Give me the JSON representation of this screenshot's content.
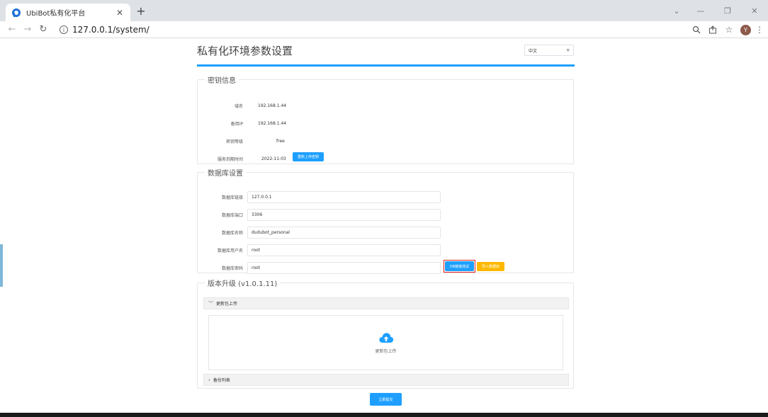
{
  "browser": {
    "tab_title": "UbiBot私有化平台",
    "url": "127.0.0.1/system/",
    "profile_initial": "Y"
  },
  "page": {
    "title": "私有化环境参数设置",
    "language": "中文"
  },
  "key_section": {
    "legend": "密钥信息",
    "fields": [
      {
        "label": "域名",
        "value": "192.168.1.44"
      },
      {
        "label": "备用IP",
        "value": "192.168.1.44"
      },
      {
        "label": "密钥等级",
        "value": "free"
      },
      {
        "label": "服务到期时间",
        "value": "2022-11-03"
      }
    ],
    "reupload_label": "重新上传密钥"
  },
  "db_section": {
    "legend": "数据库设置",
    "fields": [
      {
        "label": "数据库链接",
        "value": "127.0.0.1"
      },
      {
        "label": "数据库端口",
        "value": "3306"
      },
      {
        "label": "数据库名称",
        "value": "dudubot_personal"
      },
      {
        "label": "数据库用户名",
        "value": "root"
      },
      {
        "label": "数据库密码",
        "value": "root"
      }
    ],
    "test_label": "DB链接测试",
    "import_label": "导入数据库"
  },
  "version_section": {
    "legend": "版本升级 (v1.0.1.11)",
    "upload_panel_title": "更新包上传",
    "upload_area_text": "更新包上传",
    "backup_panel_title": "备份列表"
  },
  "submit_label": "立即提交",
  "colors": {
    "accent_blue": "#1e9fff",
    "warn_orange": "#ffb800",
    "highlight_red": "#e02020"
  }
}
